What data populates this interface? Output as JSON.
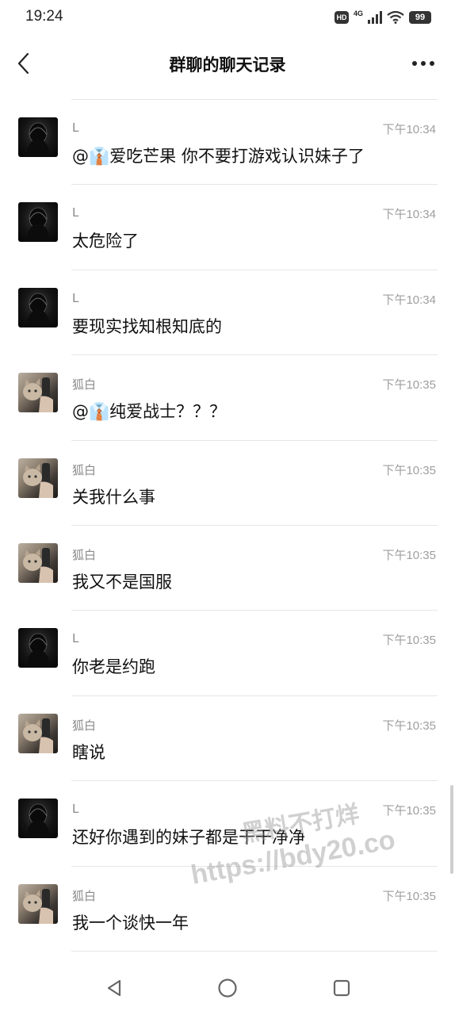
{
  "status_bar": {
    "time": "19:24",
    "hd": "HD",
    "network": "4G",
    "battery": "99"
  },
  "header": {
    "title": "群聊的聊天记录"
  },
  "messages": [
    {
      "sender": "L",
      "time": "下午10:34",
      "text": "@👔爱吃芒果 你不要打游戏认识妹子了",
      "avatar": "dark-hooded-figure"
    },
    {
      "sender": "L",
      "time": "下午10:34",
      "text": "太危险了",
      "avatar": "dark-hooded-figure"
    },
    {
      "sender": "L",
      "time": "下午10:34",
      "text": "要现实找知根知底的",
      "avatar": "dark-hooded-figure"
    },
    {
      "sender": "狐白",
      "time": "下午10:35",
      "text": "@👔纯爱战士？？？",
      "avatar": "cat-photo"
    },
    {
      "sender": "狐白",
      "time": "下午10:35",
      "text": "关我什么事",
      "avatar": "cat-photo"
    },
    {
      "sender": "狐白",
      "time": "下午10:35",
      "text": "我又不是国服",
      "avatar": "cat-photo"
    },
    {
      "sender": "L",
      "time": "下午10:35",
      "text": "你老是约跑",
      "avatar": "dark-hooded-figure"
    },
    {
      "sender": "狐白",
      "time": "下午10:35",
      "text": "瞎说",
      "avatar": "cat-photo"
    },
    {
      "sender": "L",
      "time": "下午10:35",
      "text": "还好你遇到的妹子都是干干净净",
      "avatar": "dark-hooded-figure"
    },
    {
      "sender": "狐白",
      "time": "下午10:35",
      "text": "我一个谈快一年",
      "avatar": "cat-photo"
    }
  ],
  "watermark": {
    "line1": "黑料不打烊",
    "line2": "https://bdy20.co"
  },
  "icons": {
    "back": "back-arrow-icon",
    "more": "more-dots-icon",
    "nav_back": "triangle-back-icon",
    "nav_home": "circle-home-icon",
    "nav_recent": "square-recent-icon"
  }
}
